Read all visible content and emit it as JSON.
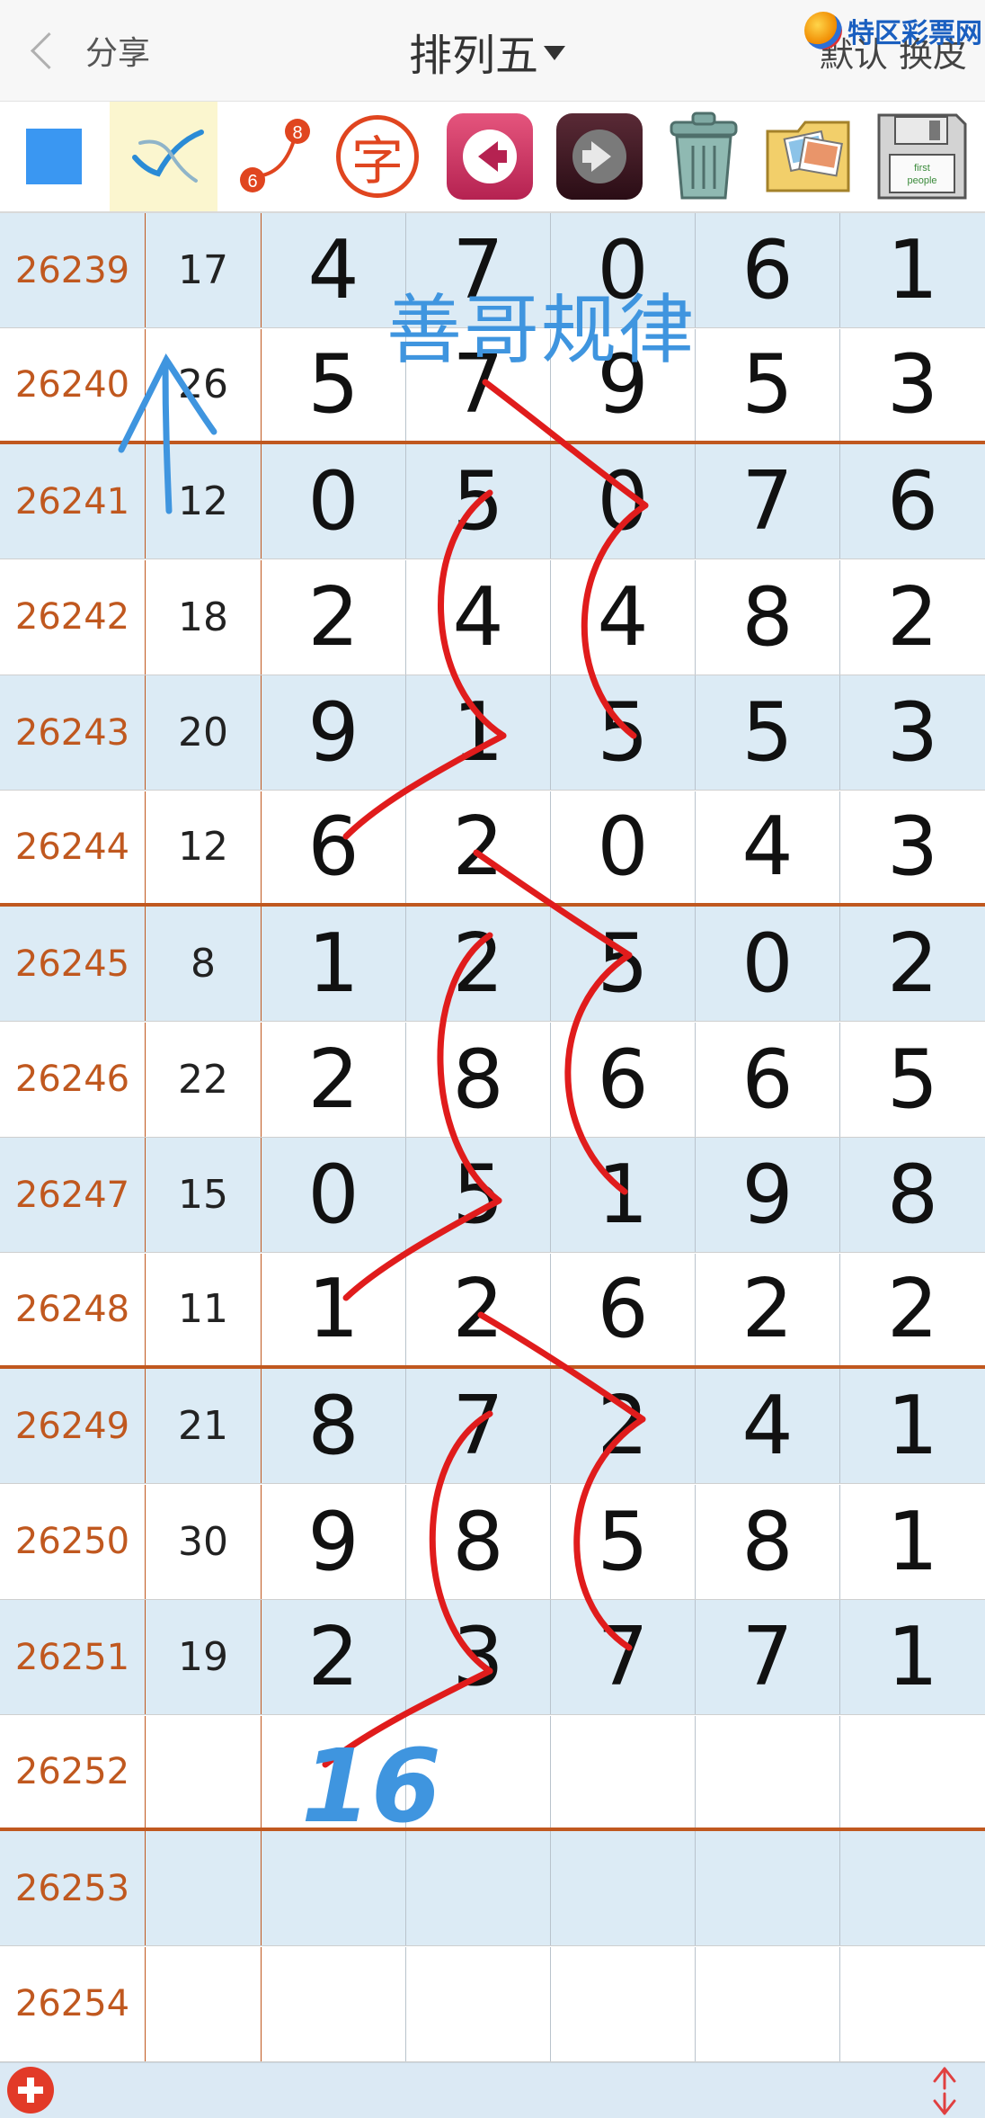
{
  "header": {
    "share_label": "分享",
    "title": "排列五",
    "right_label": "默认 换皮",
    "logo_text": "特区彩票网"
  },
  "toolbar": {
    "items": [
      {
        "icon": "blue-square-icon"
      },
      {
        "icon": "pen-check-icon"
      },
      {
        "icon": "connect-6-8-icon",
        "labels": [
          "6",
          "8"
        ]
      },
      {
        "icon": "zi-character-icon",
        "label": "字"
      },
      {
        "icon": "arrow-left-icon"
      },
      {
        "icon": "arrow-right-icon"
      },
      {
        "icon": "trash-can-icon"
      },
      {
        "icon": "photo-folder-icon"
      },
      {
        "icon": "floppy-disk-icon",
        "label": "first\npeople"
      }
    ]
  },
  "rows": [
    {
      "issue": "26239",
      "sum": "17",
      "digits": [
        "4",
        "7",
        "0",
        "6",
        "1"
      ]
    },
    {
      "issue": "26240",
      "sum": "26",
      "digits": [
        "5",
        "7",
        "9",
        "5",
        "3"
      ]
    },
    {
      "issue": "26241",
      "sum": "12",
      "digits": [
        "0",
        "5",
        "0",
        "7",
        "6"
      ]
    },
    {
      "issue": "26242",
      "sum": "18",
      "digits": [
        "2",
        "4",
        "4",
        "8",
        "2"
      ]
    },
    {
      "issue": "26243",
      "sum": "20",
      "digits": [
        "9",
        "1",
        "5",
        "5",
        "3"
      ]
    },
    {
      "issue": "26244",
      "sum": "12",
      "digits": [
        "6",
        "2",
        "0",
        "4",
        "3"
      ]
    },
    {
      "issue": "26245",
      "sum": "8",
      "digits": [
        "1",
        "2",
        "5",
        "0",
        "2"
      ]
    },
    {
      "issue": "26246",
      "sum": "22",
      "digits": [
        "2",
        "8",
        "6",
        "6",
        "5"
      ]
    },
    {
      "issue": "26247",
      "sum": "15",
      "digits": [
        "0",
        "5",
        "1",
        "9",
        "8"
      ]
    },
    {
      "issue": "26248",
      "sum": "11",
      "digits": [
        "1",
        "2",
        "6",
        "2",
        "2"
      ]
    },
    {
      "issue": "26249",
      "sum": "21",
      "digits": [
        "8",
        "7",
        "2",
        "4",
        "1"
      ]
    },
    {
      "issue": "26250",
      "sum": "30",
      "digits": [
        "9",
        "8",
        "5",
        "8",
        "1"
      ]
    },
    {
      "issue": "26251",
      "sum": "19",
      "digits": [
        "2",
        "3",
        "7",
        "7",
        "1"
      ]
    },
    {
      "issue": "26252",
      "sum": "",
      "digits": [
        "",
        "",
        "",
        "",
        ""
      ]
    },
    {
      "issue": "26253",
      "sum": "",
      "digits": [
        "",
        "",
        "",
        "",
        ""
      ]
    },
    {
      "issue": "26254",
      "sum": "",
      "digits": [
        "",
        "",
        "",
        "",
        ""
      ]
    }
  ],
  "annotations": {
    "title": "善哥规律",
    "handwritten_number": "16",
    "stroke_color": "#e01c1c",
    "blue_color": "#3f95df"
  },
  "colors": {
    "accent": "#c0581f",
    "row_alt": "#dcebf5"
  }
}
